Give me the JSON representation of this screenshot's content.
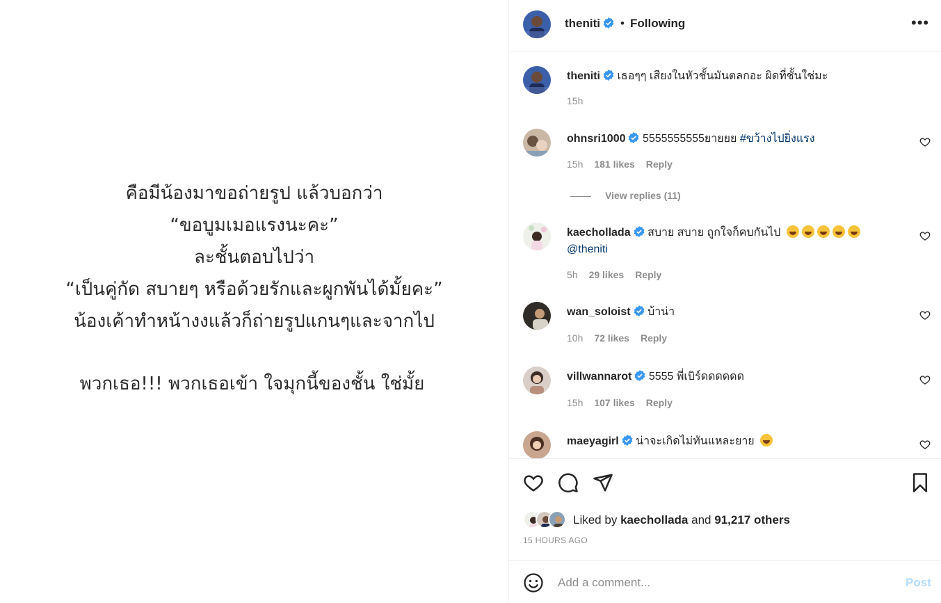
{
  "post": {
    "image_lines": [
      "คือมีน้องมาขอถ่ายรูป แล้วบอกว่า",
      "“ขอบูมเมอแรงนะคะ”",
      "ละชั้นตอบไปว่า",
      "“เป็นคู่กัด สบายๆ หรือด้วยรักและผูกพันได้มั้ยคะ”",
      "น้องเค้าทำหน้างงแล้วก็ถ่ายรูปแกนๆและจากไป",
      "พวกเธอ!!! พวกเธอเข้า ใจมุกนี้ของชั้น ใช่มั้ย"
    ]
  },
  "header": {
    "username": "theniti",
    "separator": "•",
    "follow_status": "Following",
    "more_icon": "more-horizontal-icon"
  },
  "caption": {
    "username": "theniti",
    "text": "เธอๆๆ เสียงในหัวชั้นมันตลกอะ ผิดที่ชั้นใช่มะ",
    "time": "15h"
  },
  "comments": [
    {
      "username": "ohnsri1000",
      "text": "5555555555ยายยย ",
      "hashtag": "#ขว้างไปยิ่งแรง",
      "time": "15h",
      "likes": "181 likes",
      "reply": "Reply",
      "view_replies": "View replies (11)"
    },
    {
      "username": "kaechollada",
      "text": "สบาย สบาย ถูกใจก็คบกันไป",
      "emoji_count": 5,
      "mention": "@theniti",
      "time": "5h",
      "likes": "29 likes",
      "reply": "Reply"
    },
    {
      "username": "wan_soloist",
      "text": "บ้าน่า",
      "time": "10h",
      "likes": "72 likes",
      "reply": "Reply"
    },
    {
      "username": "villwannarot",
      "text": "5555 พี่เบิร์ดดดดดด",
      "time": "15h",
      "likes": "107 likes",
      "reply": "Reply"
    },
    {
      "username": "maeyagirl",
      "text": "น่าจะเกิดไม่ทันแหละยาย",
      "emoji_count": 1
    }
  ],
  "likes": {
    "prefix": "Liked by",
    "user": "kaechollada",
    "and": "and",
    "count": "91,217 others"
  },
  "timestamp": "15 HOURS AGO",
  "add_comment": {
    "placeholder": "Add a comment...",
    "post_label": "Post"
  },
  "colors": {
    "verified": "#3897f0",
    "link": "#00376b",
    "muted": "#8e8e8e",
    "post_disabled": "#b3dbff"
  }
}
